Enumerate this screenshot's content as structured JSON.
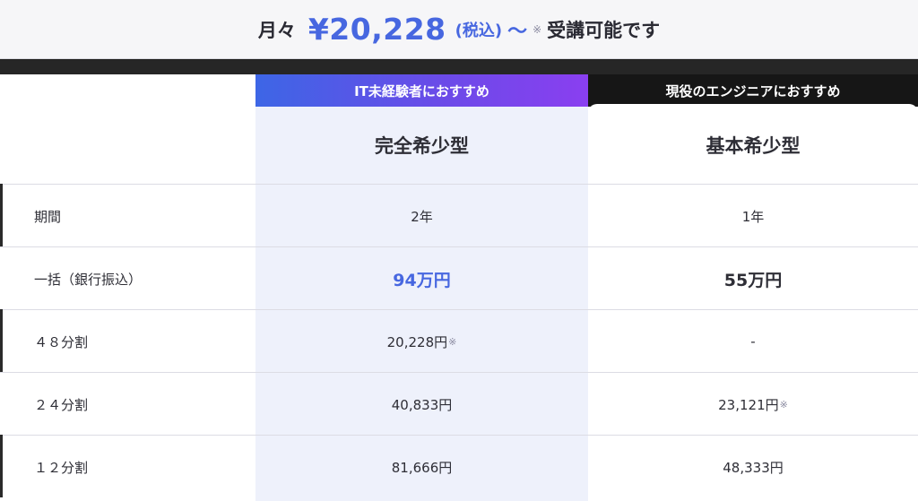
{
  "banner": {
    "lead": "月々",
    "price": "¥20,228",
    "tax": "(税込)",
    "tilde": "〜",
    "mark": "※",
    "tail": "受講可能です"
  },
  "plans": {
    "a": {
      "tag": "IT未経験者におすすめ",
      "title": "完全希少型"
    },
    "b": {
      "tag": "現役のエンジニアにおすすめ",
      "title": "基本希少型"
    }
  },
  "rows": [
    {
      "label": "期間",
      "a": "2年",
      "a_note": "",
      "b": "1年",
      "b_note": ""
    },
    {
      "label": "一括（銀行振込）",
      "a": "94万円",
      "a_note": "",
      "b": "55万円",
      "b_note": ""
    },
    {
      "label": "４８分割",
      "a": "20,228円",
      "a_note": "※",
      "b": "-",
      "b_note": ""
    },
    {
      "label": "２４分割",
      "a": "40,833円",
      "a_note": "",
      "b": "23,121円",
      "b_note": "※"
    },
    {
      "label": "１２分割",
      "a": "81,666円",
      "a_note": "",
      "b": "48,333円",
      "b_note": ""
    }
  ],
  "colors": {
    "accent": "#4767e0",
    "tag_a_gradient_start": "#3d66e6",
    "tag_a_gradient_end": "#8a3ff0",
    "tag_b_bg": "#161616",
    "col_a_bg": "#eef1fb"
  }
}
